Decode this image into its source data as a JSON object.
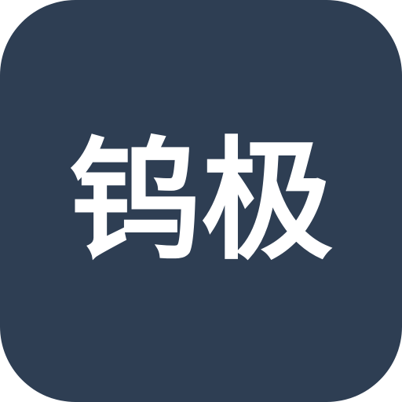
{
  "app_icon": {
    "label": "钨极",
    "background_color": "#2e3e53",
    "text_color": "#ffffff"
  }
}
